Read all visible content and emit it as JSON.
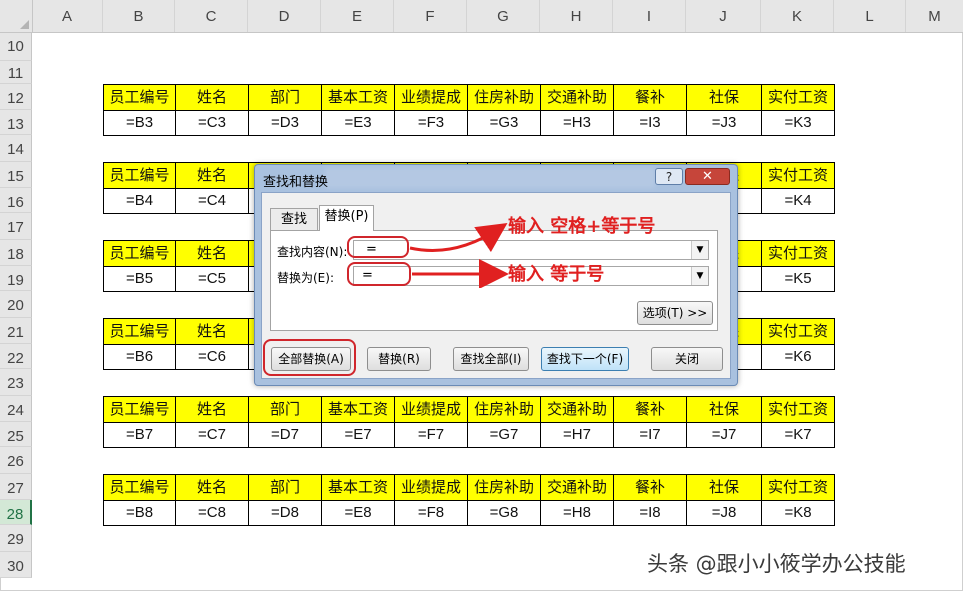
{
  "sheet": {
    "columns": [
      "A",
      "B",
      "C",
      "D",
      "E",
      "F",
      "G",
      "H",
      "I",
      "J",
      "K",
      "L",
      "M"
    ],
    "rows": [
      "10",
      "11",
      "12",
      "13",
      "14",
      "15",
      "16",
      "17",
      "18",
      "19",
      "20",
      "21",
      "22",
      "23",
      "24",
      "25",
      "26",
      "27",
      "28",
      "29",
      "30"
    ],
    "selected_row": "28",
    "headers": [
      "员工编号",
      "姓名",
      "部门",
      "基本工资",
      "业绩提成",
      "住房补助",
      "交通补助",
      "餐补",
      "社保",
      "实付工资"
    ],
    "value_rows": [
      [
        "=B3",
        "=C3",
        "=D3",
        "=E3",
        "=F3",
        "=G3",
        "=H3",
        "=I3",
        "=J3",
        "=K3"
      ],
      [
        "=B4",
        "=C4",
        "",
        "",
        "",
        "",
        "",
        "",
        "",
        "=K4"
      ],
      [
        "=B5",
        "=C5",
        "",
        "",
        "",
        "",
        "",
        "",
        "",
        "=K5"
      ],
      [
        "=B6",
        "=C6",
        "",
        "",
        "",
        "",
        "",
        "",
        "",
        "=K6"
      ],
      [
        "=B7",
        "=C7",
        "=D7",
        "=E7",
        "=F7",
        "=G7",
        "=H7",
        "=I7",
        "=J7",
        "=K7"
      ],
      [
        "=B8",
        "=C8",
        "=D8",
        "=E8",
        "=F8",
        "=G8",
        "=H8",
        "=I8",
        "=J8",
        "=K8"
      ]
    ]
  },
  "dialog": {
    "title": "查找和替换",
    "help": "?",
    "close": "✕",
    "tab_find": "查找(D)",
    "tab_replace": "替换(P)",
    "find_label": "查找内容(N):",
    "find_value": "=",
    "replace_label": "替换为(E):",
    "replace_value": "=",
    "options_button": "选项(T) >>",
    "replace_all_button": "全部替换(A)",
    "replace_button": "替换(R)",
    "find_all_button": "查找全部(I)",
    "find_next_button": "查找下一个(F)",
    "close_button": "关闭"
  },
  "annotations": {
    "find_note": "输入 空格+等于号",
    "replace_note": "输入 等于号",
    "color": "#e02020"
  },
  "watermark": "头条 @跟小小筱学办公技能",
  "colors": {
    "header_fill": "#ffff00",
    "highlight": "#d0262c"
  }
}
